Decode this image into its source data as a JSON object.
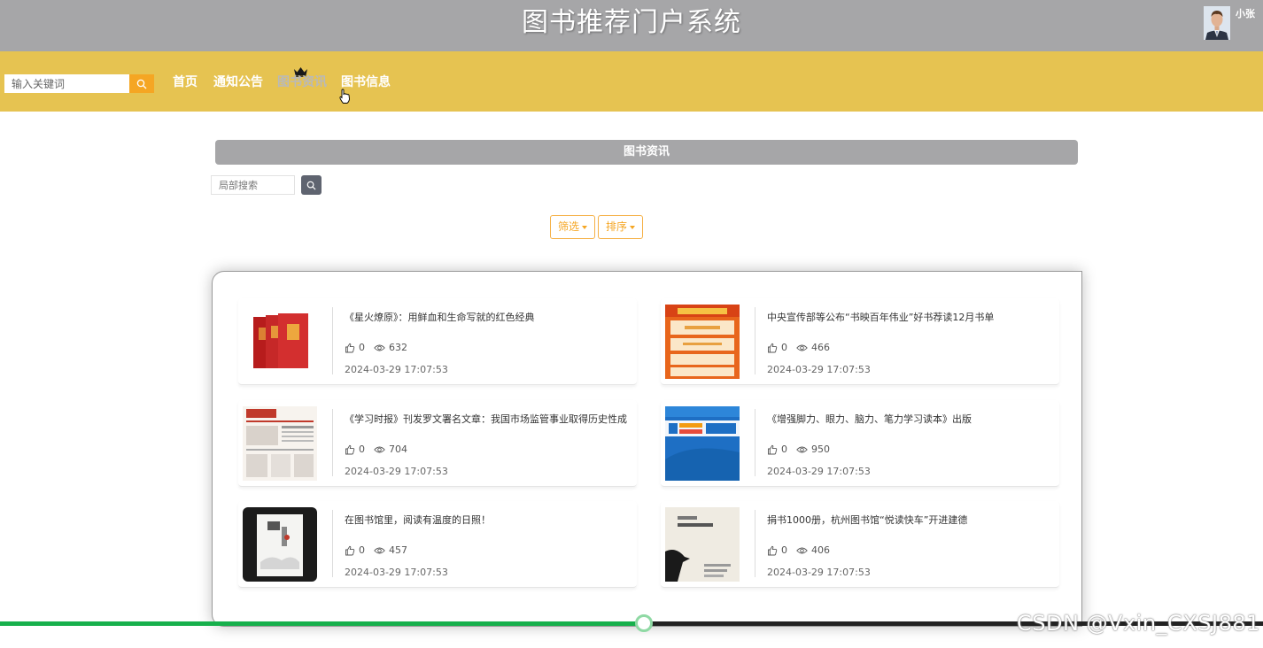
{
  "header": {
    "site_title": "图书推荐门户系统",
    "username": "小张"
  },
  "navbar": {
    "search_placeholder": "输入关键词",
    "items": [
      {
        "label": "首页",
        "active": false
      },
      {
        "label": "通知公告",
        "active": false
      },
      {
        "label": "图书资讯",
        "active": true
      },
      {
        "label": "图书信息",
        "active": false
      }
    ]
  },
  "section": {
    "heading": "图书资讯",
    "local_search_placeholder": "局部搜索",
    "filter_label": "筛选",
    "sort_label": "排序"
  },
  "articles": [
    {
      "title": "《星火燎原》：用鲜血和生命写就的红色经典",
      "likes": "0",
      "views": "632",
      "time": "2024-03-29 17:07:53"
    },
    {
      "title": "中央宣传部等公布“书映百年伟业”好书荐读12月书单",
      "likes": "0",
      "views": "466",
      "time": "2024-03-29 17:07:53"
    },
    {
      "title": "《学习时报》刊发罗文署名文章：我国市场监管事业取得历史性成",
      "likes": "0",
      "views": "704",
      "time": "2024-03-29 17:07:53"
    },
    {
      "title": "《增强脚力、眼力、脑力、笔力学习读本》出版",
      "likes": "0",
      "views": "950",
      "time": "2024-03-29 17:07:53"
    },
    {
      "title": "在图书馆里，阅读有温度的日照！",
      "likes": "0",
      "views": "457",
      "time": "2024-03-29 17:07:53"
    },
    {
      "title": "捐书1000册，杭州图书馆“悦读快车”开进建德",
      "likes": "0",
      "views": "406",
      "time": "2024-03-29 17:07:53"
    }
  ],
  "player": {
    "progress": 0.51
  },
  "watermark": "CSDN @Vxin_CXSJ881",
  "colors": {
    "topbar": "#a6a6a8",
    "navbar": "#e6c351",
    "accent": "#f5a623",
    "progress": "#17b04c"
  }
}
